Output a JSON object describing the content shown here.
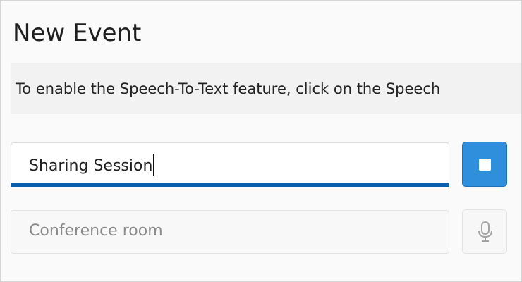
{
  "dialog": {
    "title": "New Event",
    "info_text": "To enable the Speech-To-Text feature, click on the Speech"
  },
  "fields": {
    "event_name": {
      "value": "Sharing Session"
    },
    "location": {
      "placeholder": "Conference room"
    }
  },
  "buttons": {
    "stop_icon": "stop-icon",
    "mic_icon": "microphone-icon"
  },
  "colors": {
    "accent": "#2f8fdc",
    "active_underline": "#0a5fb0"
  }
}
